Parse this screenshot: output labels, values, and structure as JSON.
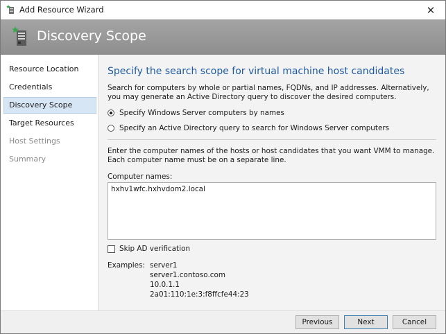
{
  "window": {
    "title": "Add Resource Wizard",
    "close_glyph": "✕"
  },
  "banner": {
    "title": "Discovery Scope"
  },
  "sidebar": {
    "items": [
      {
        "label": "Resource Location",
        "state": "normal"
      },
      {
        "label": "Credentials",
        "state": "normal"
      },
      {
        "label": "Discovery Scope",
        "state": "active"
      },
      {
        "label": "Target Resources",
        "state": "normal"
      },
      {
        "label": "Host Settings",
        "state": "disabled"
      },
      {
        "label": "Summary",
        "state": "disabled"
      }
    ]
  },
  "main": {
    "heading": "Specify the search scope for virtual machine host candidates",
    "description": "Search for computers by whole or partial names, FQDNs, and IP addresses. Alternatively, you may generate an Active Directory query to discover the desired computers.",
    "radio_options": [
      {
        "label": "Specify Windows Server computers by names",
        "selected": true
      },
      {
        "label": "Specify an Active Directory query to search for Windows Server computers",
        "selected": false
      }
    ],
    "names_description": "Enter the computer names of the hosts or host candidates that you want VMM to manage. Each computer name must be on a separate line.",
    "computer_names_label": "Computer names:",
    "computer_names_value": "hxhv1wfc.hxhvdom2.local",
    "skip_ad_label": "Skip AD verification",
    "skip_ad_checked": false,
    "examples_label": "Examples:",
    "examples": [
      "server1",
      "server1.contoso.com",
      "10.0.1.1",
      "2a01:110:1e:3:f8ffcfe44:23"
    ]
  },
  "footer": {
    "previous_label": "Previous",
    "next_label": "Next",
    "cancel_label": "Cancel"
  },
  "colors": {
    "heading": "#1f5aa0",
    "banner": "#999999",
    "active_nav": "#d7e6f5"
  }
}
